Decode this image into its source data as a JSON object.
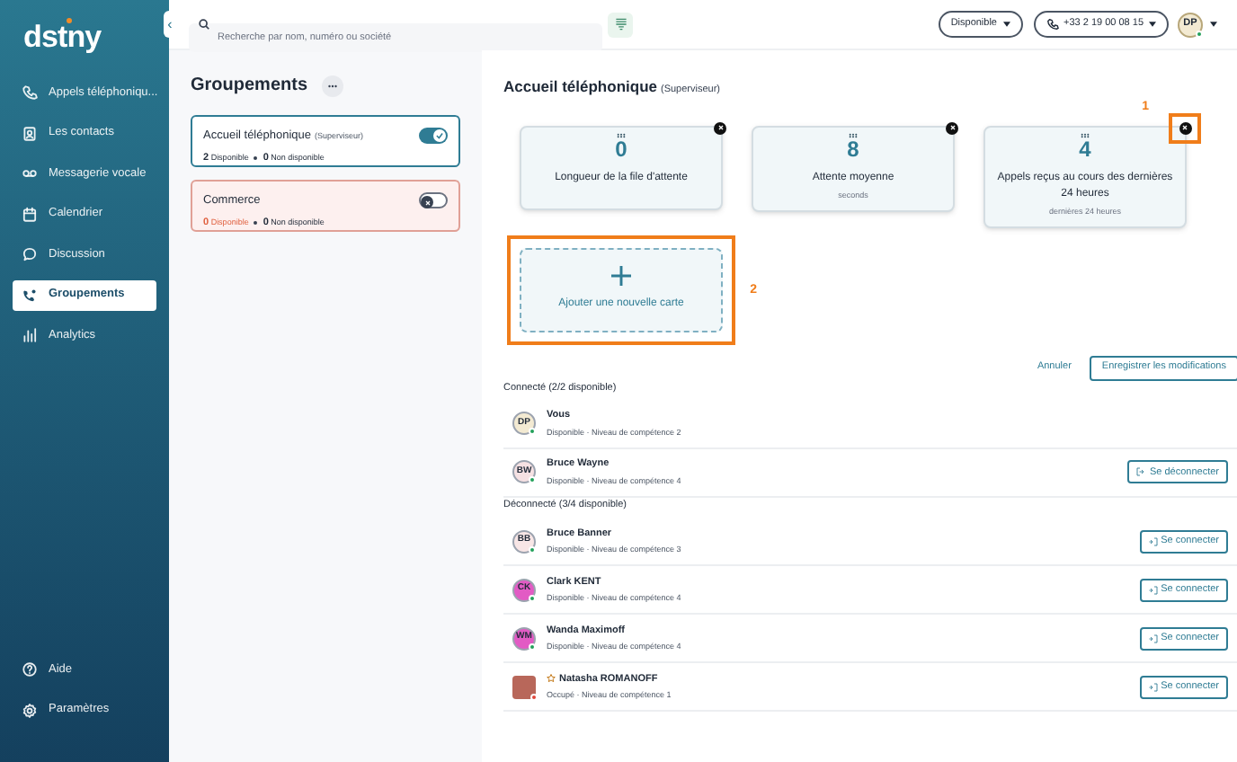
{
  "sidebar": {
    "logo": "dstny",
    "collapse_icon": "‹",
    "items": [
      {
        "label": "Appels téléphoniqu...",
        "selected": false
      },
      {
        "label": "Les contacts",
        "selected": false
      },
      {
        "label": "Messagerie vocale",
        "selected": false
      },
      {
        "label": "Calendrier",
        "selected": false
      },
      {
        "label": "Discussion",
        "selected": false
      },
      {
        "label": "Groupements",
        "selected": true
      },
      {
        "label": "Analytics",
        "selected": false
      }
    ],
    "bottom_items": [
      {
        "label": "Aide"
      },
      {
        "label": "Paramètres"
      }
    ]
  },
  "topbar": {
    "search": {
      "placeholder": "Recherche par nom, numéro ou société"
    },
    "status": "Disponible",
    "phone": "+33 2 19 00 08 15",
    "avatar": "DP"
  },
  "groups_panel": {
    "title": "Groupements",
    "groups": [
      {
        "name": "Accueil téléphonique",
        "role": "(Superviseur)",
        "available_count": "2",
        "available_label": "Disponible",
        "unavailable_count": "0",
        "unavailable_label": "Non disponible",
        "enabled": true
      },
      {
        "name": "Commerce",
        "available_count": "0",
        "available_label": "Disponible",
        "unavailable_count": "0",
        "unavailable_label": "Non disponible",
        "enabled": false
      }
    ]
  },
  "detail": {
    "title": "Accueil téléphonique",
    "role": "(Superviseur)",
    "cards": [
      {
        "value": "0",
        "label": "Longueur de la file d'attente",
        "highlighted": false
      },
      {
        "value": "8",
        "label": "Attente moyenne",
        "sublabel": "seconds",
        "highlighted": false
      },
      {
        "value": "4",
        "label": "Appels reçus au cours des dernières 24 heures",
        "sublabel": "dernières 24 heures",
        "highlighted": true,
        "marker": "1"
      }
    ],
    "add_card": {
      "label": "Ajouter une nouvelle carte",
      "highlighted": true,
      "marker": "2"
    },
    "cancel": "Annuler",
    "save": "Enregistrer les modifications",
    "sections": [
      {
        "heading": "Connecté (2/2 disponible)",
        "members": [
          {
            "kind": "initials",
            "initials": "DP",
            "color": "#f3ead2",
            "name": "Vous",
            "status": "Disponible · Niveau de compétence 2",
            "online": true
          },
          {
            "kind": "initials",
            "initials": "BW",
            "color": "#f6e1e3",
            "name": "Bruce Wayne",
            "status": "Disponible · Niveau de compétence 4",
            "online": true,
            "action": "Se déconnecter"
          }
        ]
      },
      {
        "heading": "Déconnecté (3/4 disponible)",
        "members": [
          {
            "kind": "initials",
            "initials": "BB",
            "color": "#f8e6e6",
            "name": "Bruce Banner",
            "status": "Disponible · Niveau de compétence 3",
            "online": true,
            "action": "Se connecter"
          },
          {
            "kind": "initials",
            "initials": "CK",
            "color": "#e25bc4",
            "name": "Clark KENT",
            "status": "Disponible · Niveau de compétence 4",
            "online": true,
            "action": "Se connecter"
          },
          {
            "kind": "initials",
            "initials": "WM",
            "color": "#e25bc4",
            "name": "Wanda Maximoff",
            "status": "Disponible · Niveau de compétence 4",
            "online": true,
            "action": "Se connecter"
          },
          {
            "kind": "photo",
            "starred": true,
            "name": "Natasha ROMANOFF",
            "status": "Occupé · Niveau de compétence 1",
            "online": false,
            "action": "Se connecter"
          }
        ]
      }
    ]
  }
}
